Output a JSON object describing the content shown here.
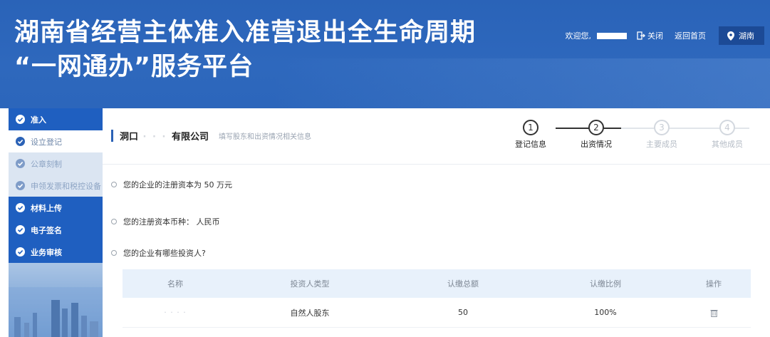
{
  "header": {
    "title_line1": "湖南省经营主体准入准营退出全生命周期",
    "title_line2": "“一网通办”服务平台",
    "welcome": "欢迎您,",
    "close_label": "关闭",
    "home_label": "返回首页",
    "region_label": "湖南"
  },
  "sidebar": {
    "items": [
      {
        "label": "准入",
        "kind": "main"
      },
      {
        "label": "设立登记",
        "kind": "sub-active"
      },
      {
        "label": "公章刻制",
        "kind": "sub"
      },
      {
        "label": "申领发票和税控设备",
        "kind": "sub"
      },
      {
        "label": "材料上传",
        "kind": "main"
      },
      {
        "label": "电子签名",
        "kind": "main"
      },
      {
        "label": "业务审核",
        "kind": "main"
      }
    ]
  },
  "company": {
    "name_prefix": "洞口",
    "name_suffix": "有限公司",
    "hint": "填写股东和出资情况相关信息"
  },
  "steps": [
    {
      "number": "1",
      "label": "登记信息",
      "state": "done"
    },
    {
      "number": "2",
      "label": "出资情况",
      "state": "current"
    },
    {
      "number": "3",
      "label": "主要成员",
      "state": "pending"
    },
    {
      "number": "4",
      "label": "其他成员",
      "state": "pending"
    }
  ],
  "questions": {
    "capital": "您的企业的注册资本为 50 万元",
    "currency": "您的注册资本币种：  人民币",
    "investors": "您的企业有哪些投资人?"
  },
  "table": {
    "headers": [
      "名称",
      "投资人类型",
      "认缴总额",
      "认缴比例",
      "操作"
    ],
    "rows": [
      {
        "name": "· · · ·",
        "type": "自然人股东",
        "amount": "50",
        "ratio": "100%"
      }
    ]
  },
  "colors": {
    "header_bg": "#2a63b8",
    "sidebar_active": "#1f5fc0",
    "table_header_bg": "#e8f1fb"
  }
}
